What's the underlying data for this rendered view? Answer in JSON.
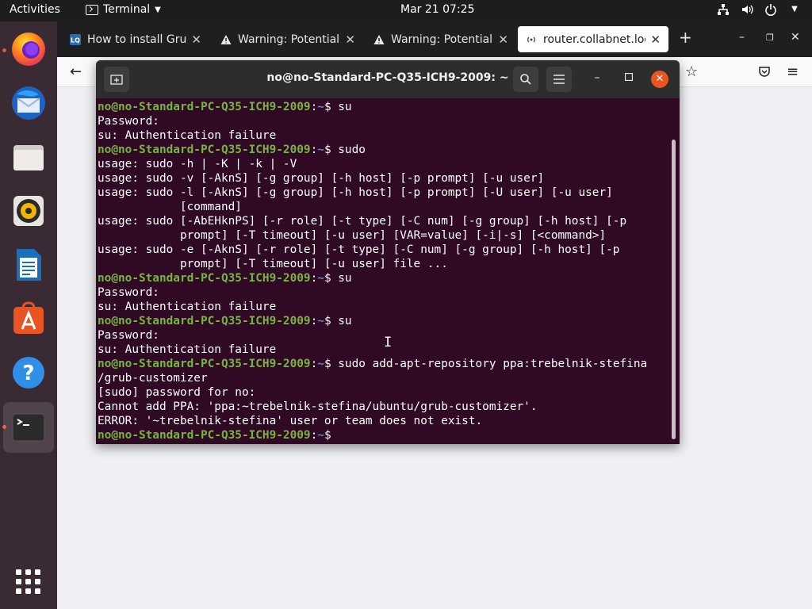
{
  "topbar": {
    "activities": "Activities",
    "app_name": "Terminal",
    "clock": "Mar 21  07:25",
    "tray_icons": [
      "network-icon",
      "volume-icon",
      "power-icon",
      "chevron-down-icon"
    ]
  },
  "dock": {
    "items": [
      {
        "name": "firefox",
        "active": false,
        "running": true
      },
      {
        "name": "thunderbird",
        "active": false,
        "running": false
      },
      {
        "name": "files",
        "active": false,
        "running": false
      },
      {
        "name": "rhythmbox",
        "active": false,
        "running": false
      },
      {
        "name": "libreoffice-writer",
        "active": false,
        "running": false
      },
      {
        "name": "ubuntu-software",
        "active": false,
        "running": false
      },
      {
        "name": "help",
        "active": false,
        "running": false
      },
      {
        "name": "terminal",
        "active": true,
        "running": true
      }
    ],
    "show_apps": "show-applications"
  },
  "browser": {
    "tabs": [
      {
        "label": "How to install Grub C",
        "icon": "lq-favicon",
        "active": false
      },
      {
        "label": "Warning: Potential Se",
        "icon": "warning-icon",
        "active": false
      },
      {
        "label": "Warning: Potential Se",
        "icon": "warning-icon",
        "active": false
      },
      {
        "label": "router.collabnet.loca",
        "icon": "wifi-icon",
        "active": true
      }
    ],
    "new_tab": "+",
    "window_controls": [
      "–",
      "❐",
      "✕"
    ]
  },
  "terminal": {
    "title": "no@no-Standard-PC-Q35-ICH9-2009: ~",
    "user_host": "no@no-Standard-PC-Q35-ICH9-2009",
    "lines": [
      {
        "kind": "prompt",
        "cmd": "su"
      },
      {
        "kind": "out",
        "text": "Password:"
      },
      {
        "kind": "out",
        "text": "su: Authentication failure"
      },
      {
        "kind": "prompt",
        "cmd": "sudo"
      },
      {
        "kind": "out",
        "text": "usage: sudo -h | -K | -k | -V"
      },
      {
        "kind": "out",
        "text": "usage: sudo -v [-AknS] [-g group] [-h host] [-p prompt] [-u user]"
      },
      {
        "kind": "out",
        "text": "usage: sudo -l [-AknS] [-g group] [-h host] [-p prompt] [-U user] [-u user]"
      },
      {
        "kind": "out",
        "text": "            [command]"
      },
      {
        "kind": "out",
        "text": "usage: sudo [-AbEHknPS] [-r role] [-t type] [-C num] [-g group] [-h host] [-p"
      },
      {
        "kind": "out",
        "text": "            prompt] [-T timeout] [-u user] [VAR=value] [-i|-s] [<command>]"
      },
      {
        "kind": "out",
        "text": "usage: sudo -e [-AknS] [-r role] [-t type] [-C num] [-g group] [-h host] [-p"
      },
      {
        "kind": "out",
        "text": "            prompt] [-T timeout] [-u user] file ..."
      },
      {
        "kind": "prompt",
        "cmd": "su"
      },
      {
        "kind": "out",
        "text": "Password:"
      },
      {
        "kind": "out",
        "text": "su: Authentication failure"
      },
      {
        "kind": "prompt",
        "cmd": "su"
      },
      {
        "kind": "out",
        "text": "Password:"
      },
      {
        "kind": "out",
        "text": "su: Authentication failure"
      },
      {
        "kind": "prompt",
        "cmd": "sudo add-apt-repository ppa:trebelnik-stefina"
      },
      {
        "kind": "out",
        "text": "/grub-customizer"
      },
      {
        "kind": "out",
        "text": "[sudo] password for no:"
      },
      {
        "kind": "out",
        "text": "Cannot add PPA: 'ppa:~trebelnik-stefina/ubuntu/grub-customizer'."
      },
      {
        "kind": "out",
        "text": "ERROR: '~trebelnik-stefina' user or team does not exist."
      },
      {
        "kind": "prompt",
        "cmd": ""
      }
    ]
  }
}
